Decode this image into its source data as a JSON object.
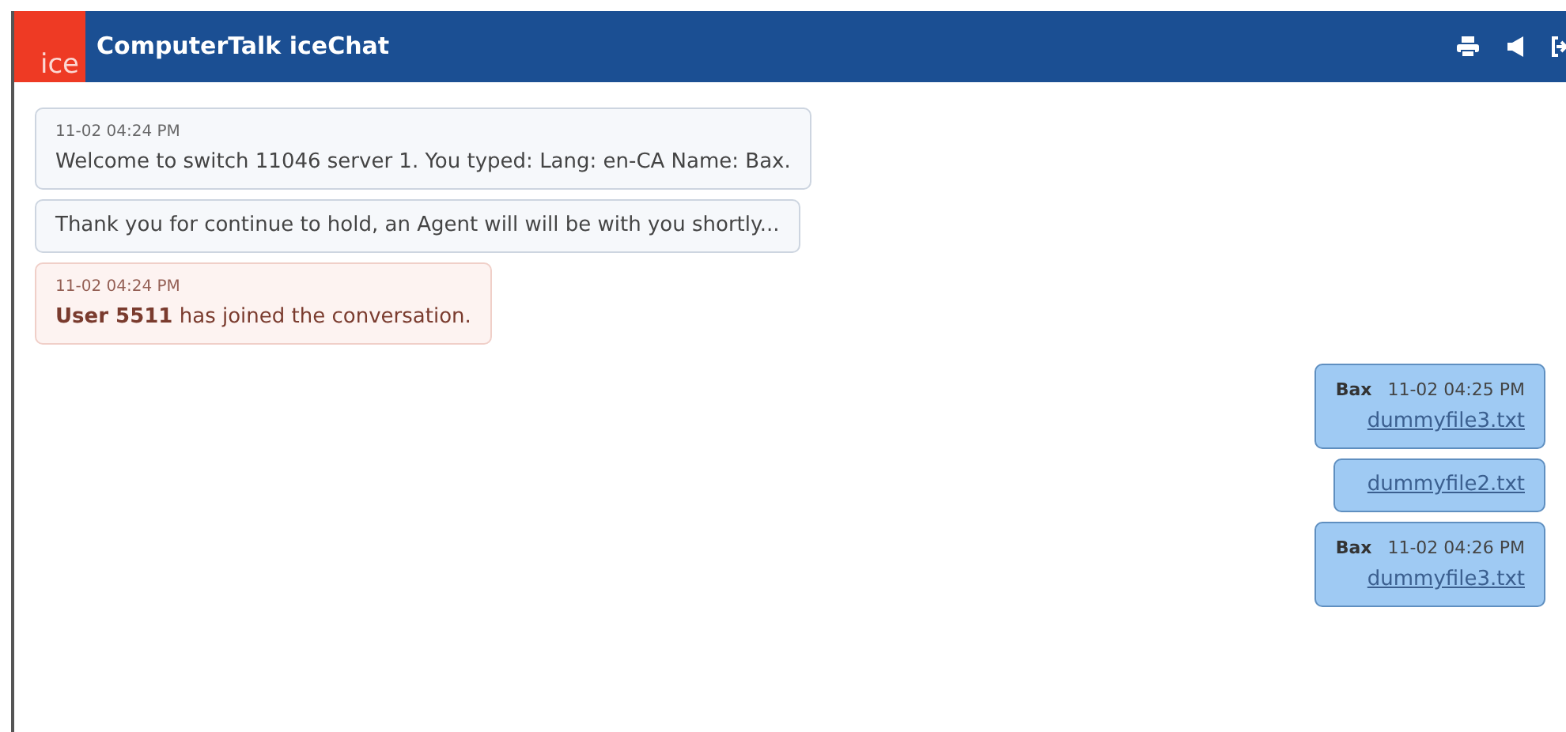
{
  "header": {
    "logo": "ice",
    "title": "ComputerTalk iceChat"
  },
  "messages": [
    {
      "kind": "system",
      "time": "11-02 04:24 PM",
      "text": "Welcome to switch 11046 server 1. You typed: Lang: en-CA Name: Bax."
    },
    {
      "kind": "system",
      "text": "Thank you for continue to hold, an Agent will will be with you shortly..."
    },
    {
      "kind": "notice",
      "time": "11-02 04:24 PM",
      "text": "**User 5511** has joined the conversation."
    },
    {
      "kind": "outgoing",
      "sender": "Bax",
      "time": "11-02 04:25 PM",
      "file": "dummyfile3.txt"
    },
    {
      "kind": "outgoing",
      "file": "dummyfile2.txt"
    },
    {
      "kind": "outgoing",
      "sender": "Bax",
      "time": "11-02 04:26 PM",
      "file": "dummyfile3.txt"
    }
  ]
}
